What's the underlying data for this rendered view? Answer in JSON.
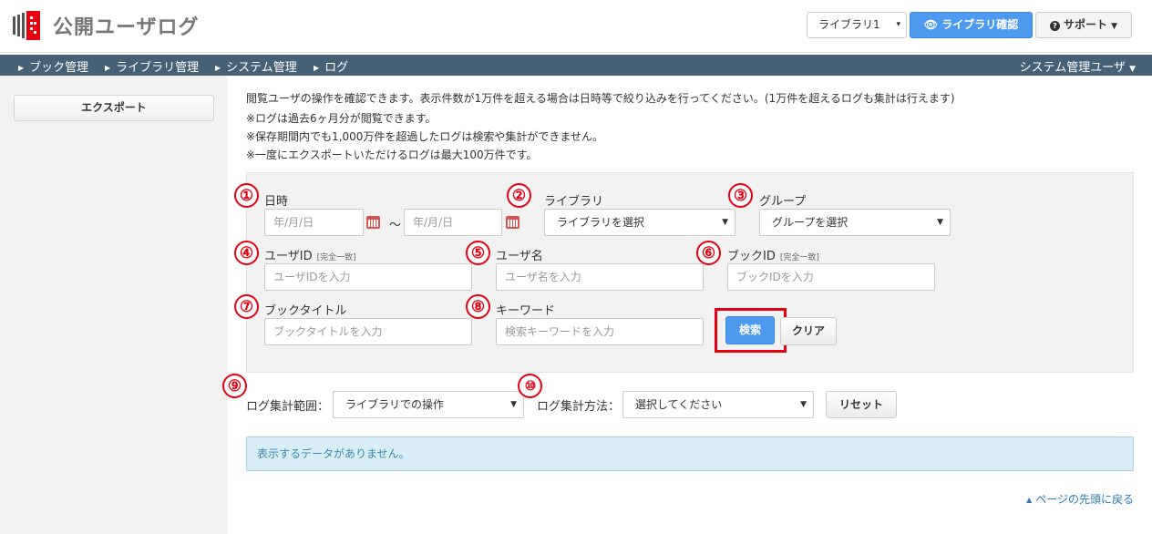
{
  "app": {
    "title": "公開ユーザログ",
    "brand_color": "#e60012"
  },
  "header": {
    "library_select": "ライブラリ1",
    "library_confirm_label": "ライブラリ確認",
    "support_label": "サポート"
  },
  "nav": {
    "items": [
      "ブック管理",
      "ライブラリ管理",
      "システム管理",
      "ログ"
    ],
    "user_menu": "システム管理ユーザ"
  },
  "sidebar": {
    "export_label": "エクスポート"
  },
  "intro": {
    "lines": [
      "閲覧ユーザの操作を確認できます。表示件数が1万件を超える場合は日時等で絞り込みを行ってください。(1万件を超えるログも集計は行えます)",
      "※ログは過去6ヶ月分が閲覧できます。",
      "※保存期間内でも1,000万件を超過したログは検索や集計ができません。",
      "※一度にエクスポートいただけるログは最大100万件です。"
    ]
  },
  "filters": {
    "datetime_label": "日時",
    "date_placeholder": "年/月/日",
    "tilde": "～",
    "library_label": "ライブラリ",
    "library_select": "ライブラリを選択",
    "group_label": "グループ",
    "group_select": "グループを選択",
    "user_id_label": "ユーザID",
    "exact_match": "[完全一致]",
    "user_id_placeholder": "ユーザIDを入力",
    "user_name_label": "ユーザ名",
    "user_name_placeholder": "ユーザ名を入力",
    "book_id_label": "ブックID",
    "book_id_placeholder": "ブックIDを入力",
    "book_title_label": "ブックタイトル",
    "book_title_placeholder": "ブックタイトルを入力",
    "keyword_label": "キーワード",
    "keyword_placeholder": "検索キーワードを入力",
    "search_label": "検索",
    "clear_label": "クリア"
  },
  "aggregate": {
    "range_label": "ログ集計範囲：",
    "range_value": "ライブラリでの操作",
    "method_label": "ログ集計方法：",
    "method_value": "選択してください",
    "reset_label": "リセット"
  },
  "result": {
    "no_data": "表示するデータがありません。"
  },
  "footer": {
    "back_to_top": "ページの先頭に戻る"
  },
  "annotations": [
    "①",
    "②",
    "③",
    "④",
    "⑤",
    "⑥",
    "⑦",
    "⑧",
    "⑨",
    "⑩"
  ]
}
